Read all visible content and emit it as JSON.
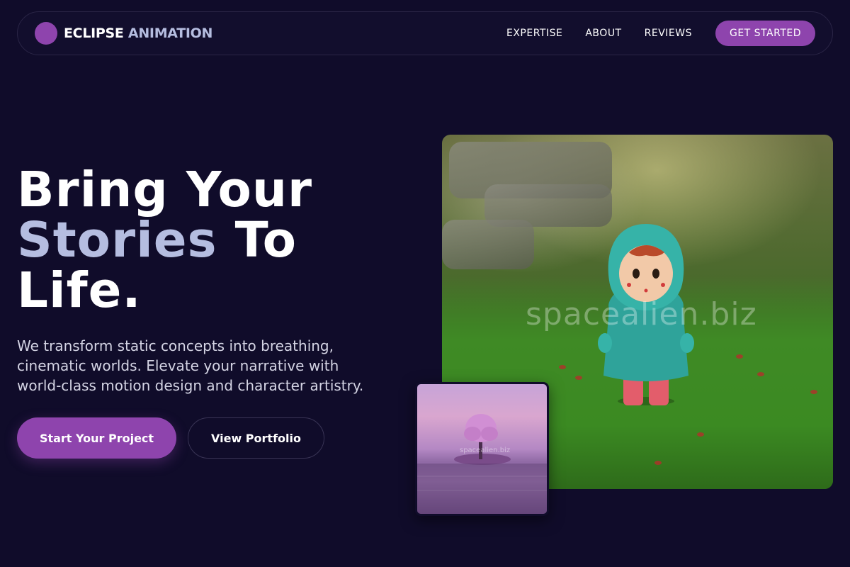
{
  "nav": {
    "brand_part1": "ECLIPSE",
    "brand_part2": "ANIMATION",
    "links": [
      "EXPERTISE",
      "ABOUT",
      "REVIEWS"
    ],
    "cta": "GET STARTED"
  },
  "hero": {
    "headline_line1": "Bring Your",
    "headline_accent": "Stories",
    "headline_line2_rest": " To",
    "headline_line3": "Life.",
    "subtext": "We transform static concepts into breathing, cinematic worlds. Elevate your narrative with world-class motion design and character artistry.",
    "primary_button": "Start Your Project",
    "secondary_button": "View Portfolio"
  },
  "images": {
    "main_watermark": "spacealien.biz",
    "thumb_watermark": "spacealien.biz"
  },
  "colors": {
    "background": "#100c2a",
    "accent": "#8e44ad",
    "headline_accent": "#b5bde0"
  }
}
